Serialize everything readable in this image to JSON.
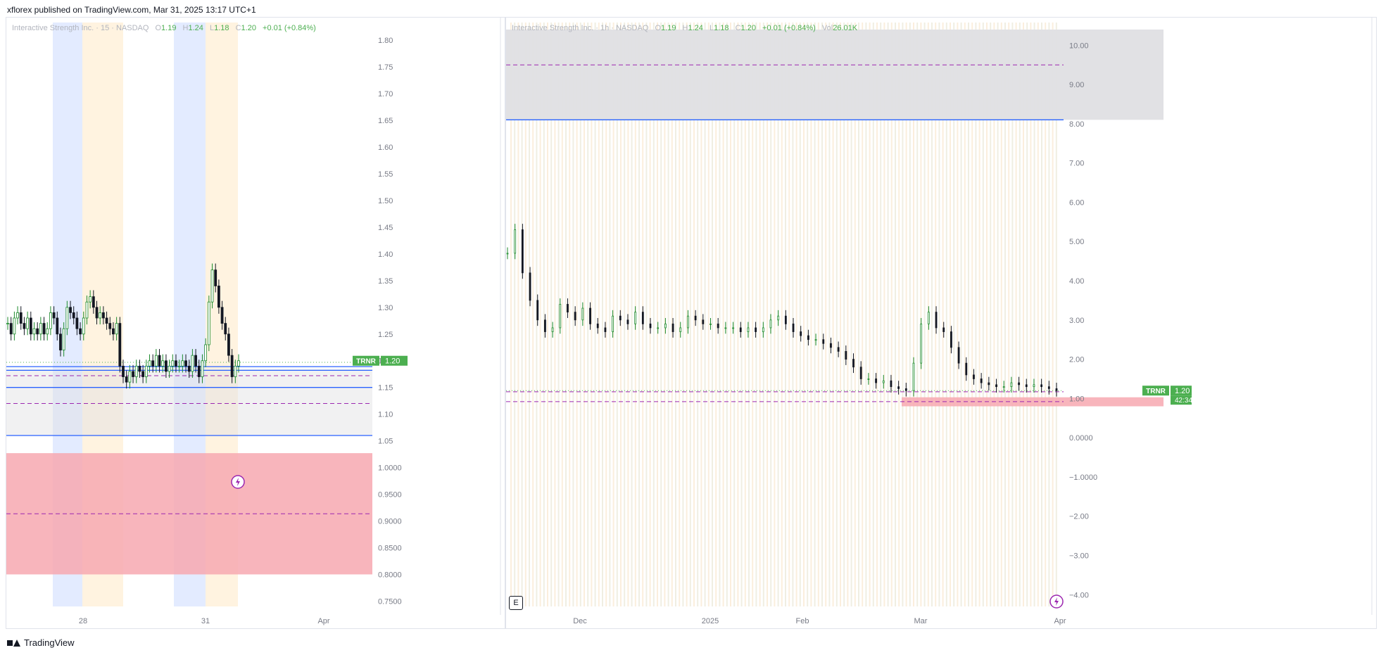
{
  "header": {
    "published": "xflorex published on TradingView.com, Mar 31, 2025 13:17 UTC+1"
  },
  "footer": {
    "brand": "TradingView"
  },
  "colors": {
    "up": "#1b8a2a",
    "down": "#131722",
    "blue_line": "#2962ff",
    "green_label": "#4caf50",
    "red_zone": "#f7a8b0",
    "grey_zone": "#dfdfe3",
    "purple_dash": "#9c27b0",
    "session_blue": "#e3ebff",
    "session_orange": "#fff3e0"
  },
  "chart_data": [
    {
      "type": "candlestick",
      "panel": "left",
      "title": "Interactive Strength Inc. · 15 · NASDAQ",
      "ohlc": {
        "O": "1.19",
        "H": "1.24",
        "L": "1.18",
        "C": "1.20",
        "change": "+0.01 (+0.84%)"
      },
      "ylim": [
        0.74,
        1.82
      ],
      "y_ticks": [
        "1.80",
        "1.75",
        "1.70",
        "1.65",
        "1.60",
        "1.55",
        "1.50",
        "1.45",
        "1.40",
        "1.35",
        "1.30",
        "1.25",
        "1.20",
        "1.15",
        "1.10",
        "1.05",
        "1.0000",
        "0.9500",
        "0.9000",
        "0.8500",
        "0.8000",
        "0.7500"
      ],
      "x_ticks": [
        "28",
        "31",
        "Apr"
      ],
      "price_label": {
        "symbol": "TRNR",
        "value": "1.20"
      },
      "levels": {
        "blue_lines": [
          1.189,
          1.182,
          1.15,
          1.06
        ],
        "purple_dashed": [
          1.172,
          1.12,
          0.9135
        ],
        "dotted_green": 1.197
      },
      "zones": [
        {
          "kind": "grey",
          "from": 1.06,
          "to": 1.185
        },
        {
          "kind": "red",
          "from": 0.8,
          "to": 1.027
        }
      ],
      "series": [
        {
          "values": [
            1.27,
            1.25,
            1.28,
            1.29,
            1.27,
            1.26,
            1.28,
            1.25,
            1.26,
            1.25,
            1.27,
            1.25,
            1.26,
            1.29,
            1.28,
            1.25,
            1.22,
            1.26,
            1.3,
            1.29,
            1.28,
            1.26,
            1.25,
            1.28,
            1.31,
            1.32,
            1.3,
            1.28,
            1.29,
            1.28,
            1.27,
            1.26,
            1.25,
            1.27,
            1.19,
            1.17,
            1.16,
            1.18,
            1.17,
            1.19,
            1.18,
            1.17,
            1.19,
            1.2,
            1.19,
            1.21,
            1.19,
            1.2,
            1.18,
            1.19,
            1.2,
            1.19,
            1.19,
            1.2,
            1.19,
            1.18,
            1.21,
            1.19,
            1.17,
            1.2,
            1.23,
            1.31,
            1.37,
            1.34,
            1.3,
            1.27,
            1.25,
            1.21,
            1.17,
            1.19,
            1.2
          ]
        }
      ]
    },
    {
      "type": "candlestick",
      "panel": "right",
      "title": "Interactive Strength Inc. · 1h · NASDAQ",
      "ohlc": {
        "O": "1.19",
        "H": "1.24",
        "L": "1.18",
        "C": "1.20",
        "change": "+0.01 (+0.84%)",
        "Vol": "26.01K"
      },
      "ylim": [
        -4.3,
        10.4
      ],
      "y_ticks": [
        "10.00",
        "9.00",
        "8.00",
        "7.00",
        "6.00",
        "5.00",
        "4.00",
        "3.00",
        "2.00",
        "1.00",
        "0.0000",
        "−1.0000",
        "−2.00",
        "−3.00",
        "−4.00"
      ],
      "x_ticks": [
        "Dec",
        "2025",
        "Feb",
        "Mar",
        "Apr"
      ],
      "price_label": {
        "symbol": "TRNR",
        "value": "1.20",
        "countdown": "42:34"
      },
      "levels": {
        "blue_line": 8.1,
        "purple_dashed": [
          9.5,
          1.17,
          0.92
        ],
        "dotted_green": 1.2
      },
      "zones": [
        {
          "kind": "grey",
          "from": 8.1,
          "to": 10.4
        },
        {
          "kind": "red",
          "from": 0.8,
          "to": 1.03
        }
      ],
      "series": [
        {
          "values": [
            4.7,
            5.3,
            4.2,
            3.5,
            3.0,
            2.7,
            2.8,
            3.4,
            3.2,
            3.0,
            3.3,
            2.9,
            2.8,
            2.7,
            3.1,
            3.0,
            2.9,
            3.2,
            2.9,
            2.8,
            2.8,
            2.9,
            2.7,
            2.8,
            3.1,
            3.0,
            2.9,
            2.9,
            2.8,
            2.8,
            2.8,
            2.7,
            2.8,
            2.7,
            2.8,
            3.0,
            3.1,
            2.9,
            2.7,
            2.6,
            2.5,
            2.5,
            2.4,
            2.3,
            2.2,
            2.0,
            1.8,
            1.5,
            1.5,
            1.4,
            1.45,
            1.3,
            1.25,
            1.2,
            1.9,
            2.9,
            3.2,
            2.8,
            2.7,
            2.3,
            1.9,
            1.6,
            1.5,
            1.4,
            1.35,
            1.3,
            1.3,
            1.4,
            1.35,
            1.3,
            1.35,
            1.3,
            1.25,
            1.2
          ]
        }
      ]
    }
  ]
}
